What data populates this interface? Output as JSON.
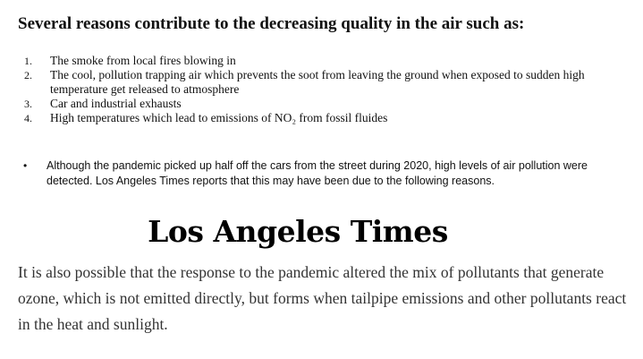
{
  "heading": "Several reasons contribute to the decreasing quality in the air such as:",
  "reasons": [
    {
      "number": "1.",
      "text": "The smoke from local fires blowing in"
    },
    {
      "number": "2.",
      "text": "The cool, pollution trapping air which prevents the soot from leaving the ground when exposed to sudden high temperature get released to atmosphere"
    },
    {
      "number": "3.",
      "text": "Car and industrial exhausts"
    },
    {
      "number": "4.",
      "text": "High temperatures which lead to emissions of NO₂ from fossil fluides"
    }
  ],
  "bullet": {
    "marker": "•",
    "text": "Although the pandemic picked up half off the cars from the street during 2020, high levels of air pollution were detected. Los Angeles Times reports that this may have been due to the following reasons."
  },
  "logo_text": "Los Angeles Times",
  "quote": "It is also possible that the response to the pandemic altered the mix of pollutants that generate ozone, which is not emitted directly, but forms when tailpipe emissions and other pollutants react in the heat and sunlight."
}
